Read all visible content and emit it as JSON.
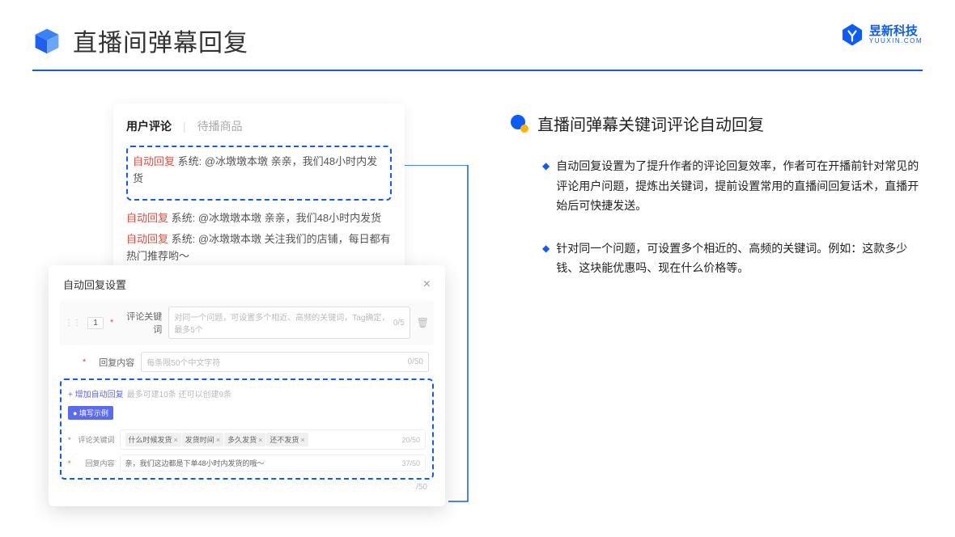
{
  "header": {
    "title": "直播间弹幕回复",
    "logo_cn": "昱新科技",
    "logo_en": "YUUXIN.COM"
  },
  "card1": {
    "tab_active": "用户评论",
    "tab_inactive": "待播商品",
    "highlighted_comment": {
      "tag": "自动回复",
      "text": "系统: @冰墩墩本墩 亲亲，我们48小时内发货"
    },
    "comments": [
      {
        "tag": "自动回复",
        "text": "系统: @冰墩墩本墩 亲亲，我们48小时内发货"
      },
      {
        "tag": "自动回复",
        "text": "系统: @冰墩墩本墩 关注我们的店铺，每日都有热门推荐哟～"
      }
    ]
  },
  "card2": {
    "title": "自动回复设置",
    "close": "×",
    "idx": "1",
    "row1": {
      "label": "评论关键词",
      "placeholder": "对同一个问题，可设置多个相近、高频的关键词，Tag确定，最多5个",
      "count": "0/5"
    },
    "row2": {
      "label": "回复内容",
      "placeholder": "每条限50个中文字符",
      "count": "0/50"
    },
    "add_link": "+ 增加自动回复",
    "add_hint": "最多可建10条 还可以创建9条",
    "example_tag": "● 填写示例",
    "exrow1": {
      "label": "评论关键词",
      "tags": [
        "什么时候发货",
        "发货时间",
        "多久发货",
        "还不发货"
      ],
      "count": "20/50"
    },
    "exrow2": {
      "label": "回复内容",
      "value": "亲，我们这边都是下单48小时内发货的哦～",
      "count": "37/50"
    },
    "trailing_count": "/50"
  },
  "right": {
    "section_title": "直播间弹幕关键词评论自动回复",
    "bullets": [
      "自动回复设置为了提升作者的评论回复效率，作者可在开播前针对常见的评论用户问题，提炼出关键词，提前设置常用的直播间回复话术，直播开始后可快捷发送。",
      "针对同一个问题，可设置多个相近的、高频的关键词。例如：这款多少钱、这块能优惠吗、现在什么价格等。"
    ]
  }
}
